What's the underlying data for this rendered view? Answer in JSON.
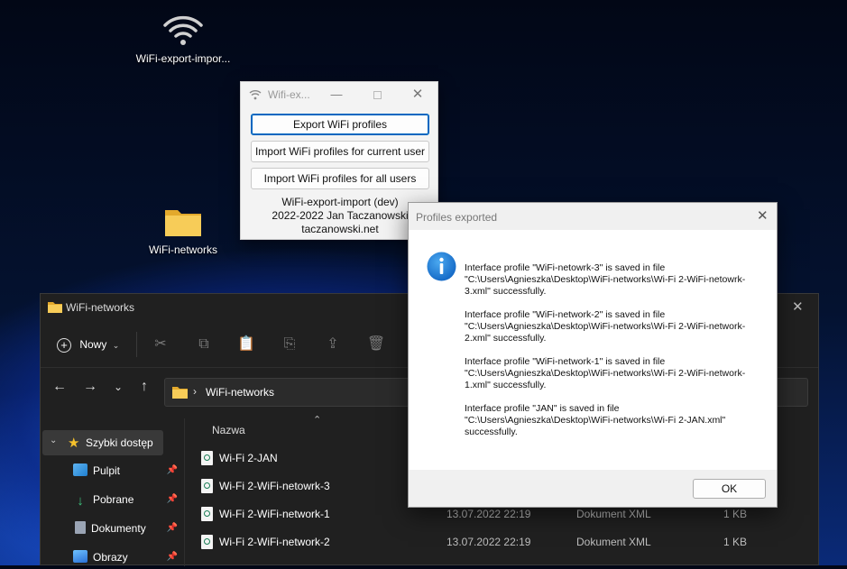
{
  "desktop": {
    "icons": [
      {
        "label": "WiFi-export-impor..."
      },
      {
        "label": "WiFi-networks"
      }
    ]
  },
  "app_window": {
    "title": "Wifi-ex...",
    "buttons": [
      {
        "label": "Export WiFi profiles"
      },
      {
        "label": "Import WiFi profiles for current user"
      },
      {
        "label": "Import WiFi profiles for all users"
      }
    ],
    "info_lines": [
      "WiFi-export-import (dev)",
      "2022-2022 Jan Taczanowski",
      "taczanowski.net"
    ]
  },
  "explorer": {
    "title": "WiFi-networks",
    "new_label": "Nowy",
    "address": "WiFi-networks",
    "column_name": "Nazwa",
    "sidebar": [
      {
        "label": "Szybki dostęp",
        "icon": "star-icon"
      },
      {
        "label": "Pulpit",
        "icon": "desktop-icon"
      },
      {
        "label": "Pobrane",
        "icon": "download-icon"
      },
      {
        "label": "Dokumenty",
        "icon": "documents-icon"
      },
      {
        "label": "Obrazy",
        "icon": "pictures-icon"
      }
    ],
    "files": [
      {
        "name": "Wi-Fi 2-JAN",
        "date": "",
        "type": "",
        "size": ""
      },
      {
        "name": "Wi-Fi 2-WiFi-netowrk-3",
        "date": "",
        "type": "",
        "size": ""
      },
      {
        "name": "Wi-Fi 2-WiFi-network-1",
        "date": "13.07.2022 22:19",
        "type": "Dokument XML",
        "size": "1 KB"
      },
      {
        "name": "Wi-Fi 2-WiFi-network-2",
        "date": "13.07.2022 22:19",
        "type": "Dokument XML",
        "size": "1 KB"
      }
    ]
  },
  "message_box": {
    "title": "Profiles exported",
    "paragraphs": [
      "Interface profile \"WiFi-netowrk-3\" is saved in file \"C:\\Users\\Agnieszka\\Desktop\\WiFi-networks\\Wi-Fi 2-WiFi-netowrk-3.xml\" successfully.",
      "Interface profile \"WiFi-network-2\" is saved in file \"C:\\Users\\Agnieszka\\Desktop\\WiFi-networks\\Wi-Fi 2-WiFi-network-2.xml\" successfully.",
      "Interface profile \"WiFi-network-1\" is saved in file \"C:\\Users\\Agnieszka\\Desktop\\WiFi-networks\\Wi-Fi 2-WiFi-network-1.xml\" successfully.",
      "Interface profile \"JAN\" is saved in file \"C:\\Users\\Agnieszka\\Desktop\\WiFi-networks\\Wi-Fi 2-JAN.xml\" successfully."
    ],
    "ok_label": "OK",
    "icon": "info-icon"
  },
  "colors": {
    "accent": "#0067c0",
    "info_icon": "#1a7fd9",
    "folder": "#f2c14e"
  }
}
